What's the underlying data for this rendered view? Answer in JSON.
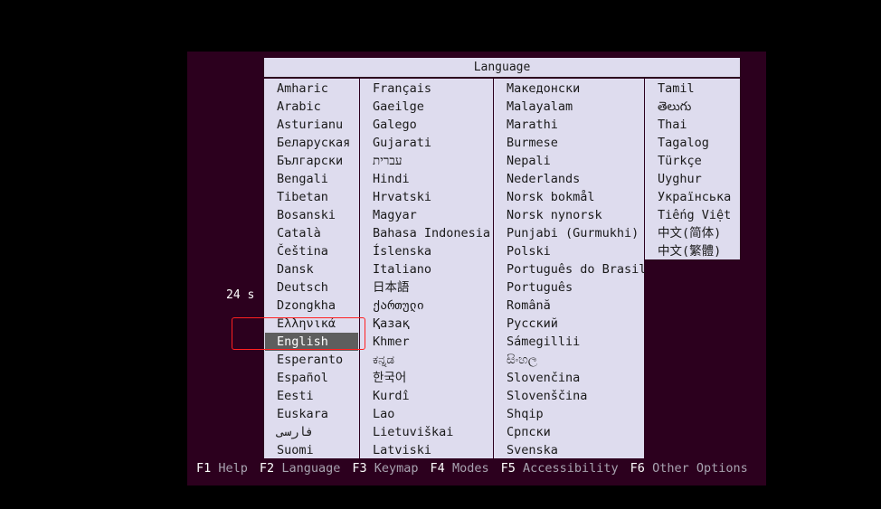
{
  "dialog": {
    "title": "Language"
  },
  "columns": [
    [
      "Amharic",
      "Arabic",
      "Asturianu",
      "Беларуская",
      "Български",
      "Bengali",
      "Tibetan",
      "Bosanski",
      "Català",
      "Čeština",
      "Dansk",
      "Deutsch",
      "Dzongkha",
      "Ελληνικά",
      "English",
      "Esperanto",
      "Español",
      "Eesti",
      "Euskara",
      "فارسی",
      "Suomi"
    ],
    [
      "Français",
      "Gaeilge",
      "Galego",
      "Gujarati",
      "עברית",
      "Hindi",
      "Hrvatski",
      "Magyar",
      "Bahasa Indonesia",
      "Íslenska",
      "Italiano",
      "日本語",
      "ქართული",
      "Қазақ",
      "Khmer",
      "ಕನ್ನಡ",
      "한국어",
      "Kurdî",
      "Lao",
      "Lietuviškai",
      "Latviski"
    ],
    [
      "Македонски",
      "Malayalam",
      "Marathi",
      "Burmese",
      "Nepali",
      "Nederlands",
      "Norsk bokmål",
      "Norsk nynorsk",
      "Punjabi (Gurmukhi)",
      "Polski",
      "Português do Brasil",
      "Português",
      "Română",
      "Русский",
      "Sámegillii",
      "සිංහල",
      "Slovenčina",
      "Slovenščina",
      "Shqip",
      "Српски",
      "Svenska"
    ],
    [
      "Tamil",
      "తెలుగు",
      "Thai",
      "Tagalog",
      "Türkçe",
      "Uyghur",
      "Українська",
      "Tiếng Việt",
      "中文(简体)",
      "中文(繁體)"
    ]
  ],
  "selected": {
    "column": 0,
    "index": 14,
    "label": "English"
  },
  "timer": "24 s",
  "function_keys": [
    {
      "key": "F1",
      "label": "Help"
    },
    {
      "key": "F2",
      "label": "Language"
    },
    {
      "key": "F3",
      "label": "Keymap"
    },
    {
      "key": "F4",
      "label": "Modes"
    },
    {
      "key": "F5",
      "label": "Accessibility"
    },
    {
      "key": "F6",
      "label": "Other Options"
    }
  ],
  "colors": {
    "screen_bg": "#2c001e",
    "menu_bg": "#dedcee",
    "selection_bg": "#5e5e5e",
    "highlight_border": "#ff2020"
  }
}
